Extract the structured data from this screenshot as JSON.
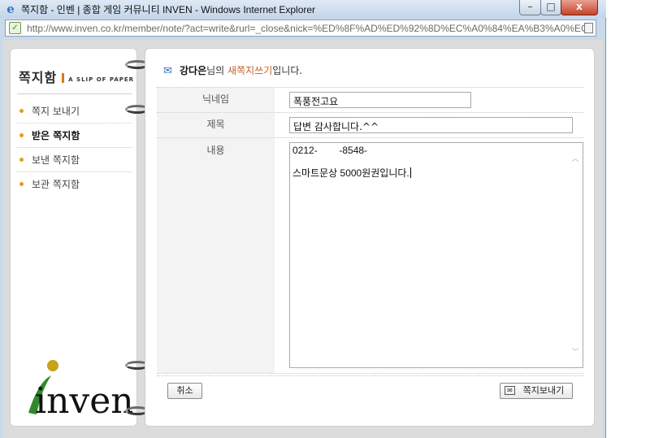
{
  "window": {
    "title": "쪽지함 - 인벤 | 종합 게임 커뮤니티 INVEN - Windows Internet Explorer",
    "url": "http://www.inven.co.kr/member/note/?act=write&rurl=_close&nick=%ED%8F%AD%ED%92%8D%EC%A0%84%EA%B3%A0%EC",
    "buttons": {
      "minimize": "–",
      "maximize": "□",
      "close": "x"
    }
  },
  "sidebar": {
    "brand_kr": "쪽지함",
    "brand_en": "A SLIP OF PAPER",
    "items": [
      {
        "label": "쪽지 보내기",
        "active": false
      },
      {
        "label": "받은 쪽지함",
        "active": true
      },
      {
        "label": "보낸 쪽지함",
        "active": false
      },
      {
        "label": "보관 쪽지함",
        "active": false
      }
    ],
    "logo_text": "inven"
  },
  "heading": {
    "name": "강다은",
    "mid": "님의 ",
    "action": "새쪽지쓰기",
    "suffix": "입니다."
  },
  "form": {
    "nickname_label": "닉네임",
    "nickname_value": "폭풍전고요",
    "subject_label": "제목",
    "subject_value": "답변 감사합니다.^^",
    "body_label": "내용",
    "body_line1": "0212-        -8548-",
    "body_line2": "",
    "body_line3": "스마트문상 5000원권입니다."
  },
  "actions": {
    "cancel_label": "취소",
    "send_label": "쪽지보내기"
  },
  "colors": {
    "accent_orange": "#e59c1c",
    "action_text": "#c4622a",
    "logo_green": "#2f8a2a",
    "logo_gold": "#c8a21a"
  }
}
